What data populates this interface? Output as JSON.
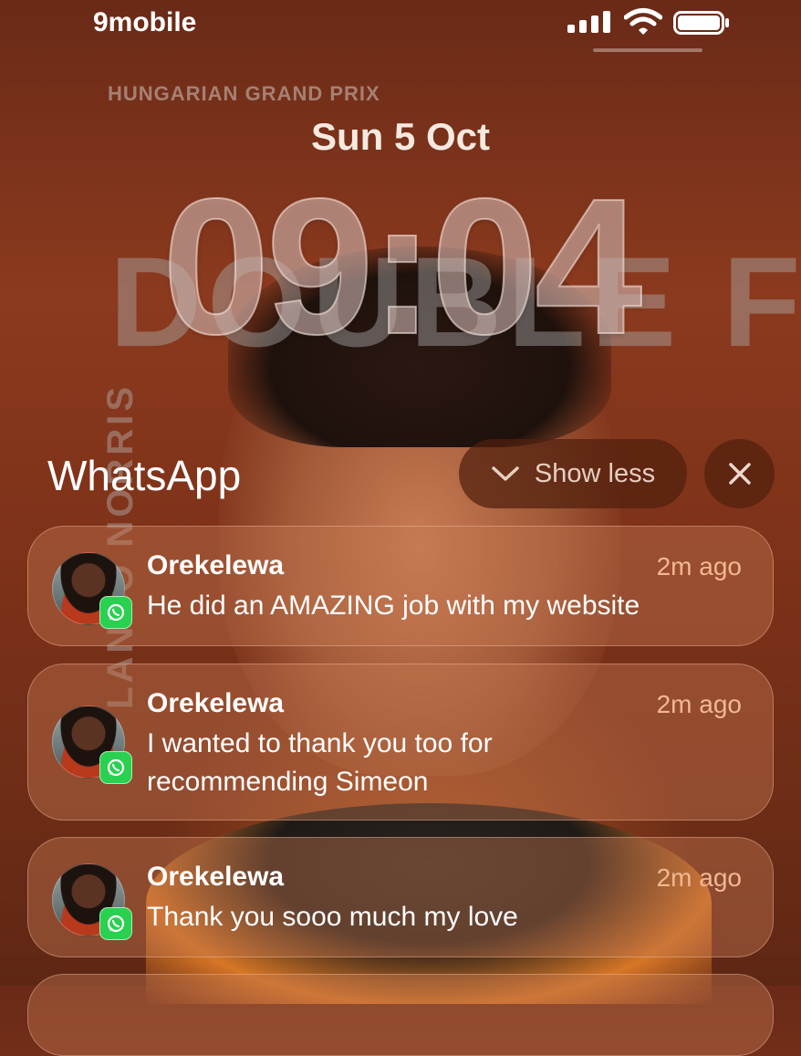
{
  "status_bar": {
    "carrier": "9mobile",
    "signal_icon": "cellular-signal-icon",
    "wifi_icon": "wifi-icon",
    "battery_icon": "battery-icon"
  },
  "wallpaper": {
    "event_bold": "HUNGARIAN",
    "event_rest": " GRAND PRIX",
    "headline": "DOUBLE F",
    "name": "LANDO NORRIS"
  },
  "lockscreen": {
    "date": "Sun 5 Oct",
    "time": "09:04"
  },
  "group": {
    "app_name": "WhatsApp",
    "show_less_label": "Show less",
    "chevron_icon": "chevron-down-icon",
    "close_icon": "close-icon"
  },
  "notifications": [
    {
      "sender": "Orekelewa",
      "time": "2m ago",
      "message": "He did an AMAZING job with my website"
    },
    {
      "sender": "Orekelewa",
      "time": "2m ago",
      "message": "I wanted to thank you too for recommending Simeon"
    },
    {
      "sender": "Orekelewa",
      "time": "2m ago",
      "message": "Thank you sooo much my love"
    }
  ],
  "colors": {
    "background": "#7e3219",
    "notification_time": "#f2b892",
    "whatsapp_green": "#2ad04f"
  }
}
